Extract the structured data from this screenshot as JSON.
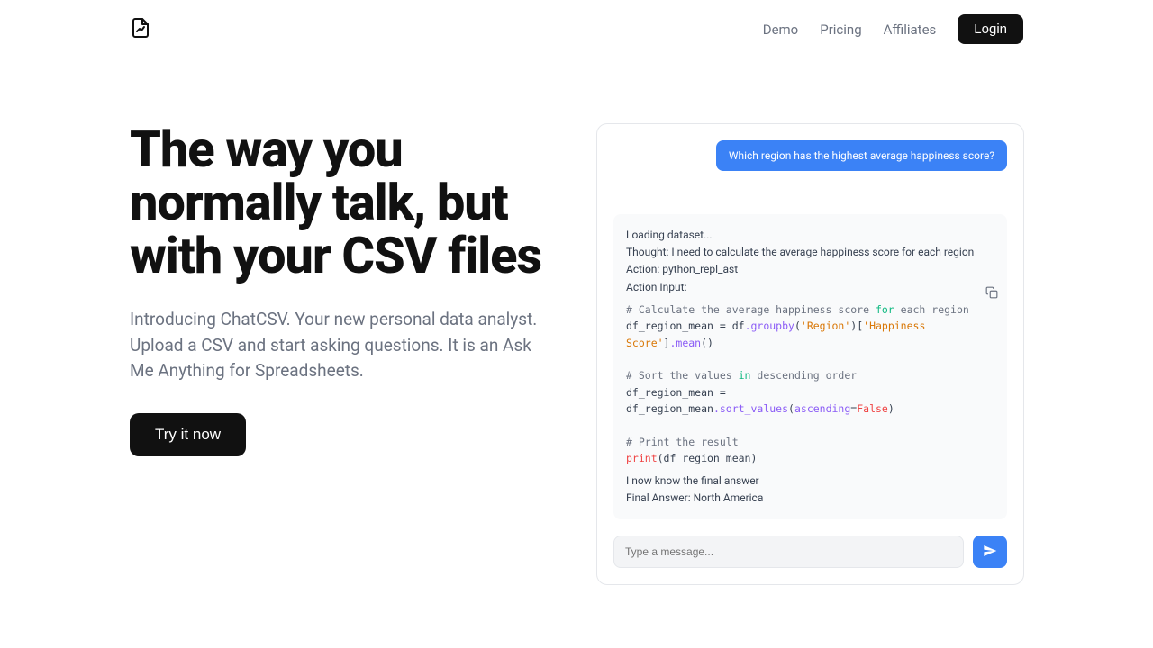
{
  "nav": {
    "demo": "Demo",
    "pricing": "Pricing",
    "affiliates": "Affiliates",
    "login": "Login"
  },
  "hero": {
    "headline": "The way you normally talk, but with your CSV files",
    "subhead": "Introducing ChatCSV. Your new personal data analyst. Upload a CSV and start asking questions. It is an Ask Me Anything for Spreadsheets.",
    "cta": "Try it now"
  },
  "chat": {
    "user_message": "Which region has the highest average happiness score?",
    "loading": "Loading dataset...",
    "thought": "Thought: I need to calculate the average happiness score for each region",
    "action": "Action: python_repl_ast",
    "action_input": "Action Input:",
    "code": {
      "c1": "# Calculate the average happiness score ",
      "c1_kw": "for",
      "c1_rest": " each region",
      "l2_a": "df_region_mean = df",
      "l2_b": ".groupby",
      "l2_c": "(",
      "l2_d": "'Region'",
      "l2_e": ")[",
      "l2_f": "'Happiness Score'",
      "l2_g": "]",
      "l2_h": ".mean",
      "l2_i": "()",
      "c3": "# Sort the values ",
      "c3_kw": "in",
      "c3_rest": " descending order",
      "l4_a": "df_region_mean = df_region_mean",
      "l4_b": ".sort_values",
      "l4_c": "(",
      "l4_d": "ascending",
      "l4_e": "=",
      "l4_f": "False",
      "l4_g": ")",
      "c5": "# Print the result",
      "l6_a": "print",
      "l6_b": "(df_region_mean)"
    },
    "know": " I now know the final answer",
    "final": "Final Answer: North America",
    "placeholder": "Type a message..."
  }
}
